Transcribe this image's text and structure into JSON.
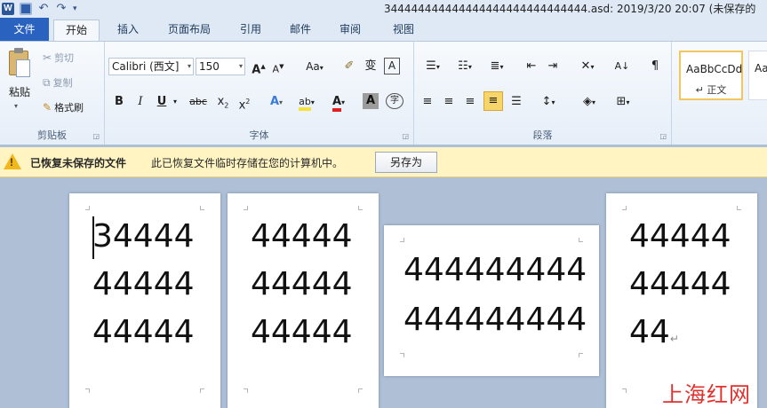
{
  "window": {
    "title": "344444444444444444444444444444.asd: 2019/3/20 20:07 (未保存的"
  },
  "quick_access": {
    "word": "W",
    "undo": "↶",
    "redo": "↷"
  },
  "tabs": [
    {
      "label": "文件"
    },
    {
      "label": "开始"
    },
    {
      "label": "插入"
    },
    {
      "label": "页面布局"
    },
    {
      "label": "引用"
    },
    {
      "label": "邮件"
    },
    {
      "label": "审阅"
    },
    {
      "label": "视图"
    }
  ],
  "clipboard": {
    "paste": "粘贴",
    "cut": "剪切",
    "copy": "复制",
    "format_painter": "格式刷",
    "group": "剪贴板"
  },
  "font": {
    "family": "Calibri (西文]",
    "size": "150",
    "grow": "A",
    "shrink": "A",
    "case": "Aa",
    "phonetic": "变",
    "border": "A",
    "bold": "B",
    "italic": "I",
    "underline": "U",
    "strike": "abc",
    "subscript": "x",
    "superscript": "x",
    "effects": "A",
    "highlight": "ab",
    "color": "A",
    "shading": "A",
    "enclose": "字",
    "group": "字体"
  },
  "paragraph": {
    "sort": "A↓",
    "show_marks": "¶",
    "group": "段落"
  },
  "styles": {
    "normal_sample": "AaBbCcDd",
    "normal_name": "正文",
    "next_sample": "Aa"
  },
  "message_bar": {
    "title": "已恢复未保存的文件",
    "text": "此已恢复文件临时存储在您的计算机中。",
    "button": "另存为"
  },
  "pages": [
    {
      "lines": [
        "34444",
        "44444",
        "44444"
      ]
    },
    {
      "lines": [
        "44444",
        "44444",
        "44444"
      ]
    },
    {
      "lines": [
        "444444444",
        "444444444"
      ]
    },
    {
      "lines": [
        "44444",
        "44444",
        "44"
      ]
    }
  ],
  "watermark": "上海红网",
  "colors": {
    "file_tab": "#2a62c0",
    "message_bar": "#fff4c2",
    "workspace": "#aebfd6",
    "font_color": "#e02020",
    "highlight": "#f7e23b"
  }
}
